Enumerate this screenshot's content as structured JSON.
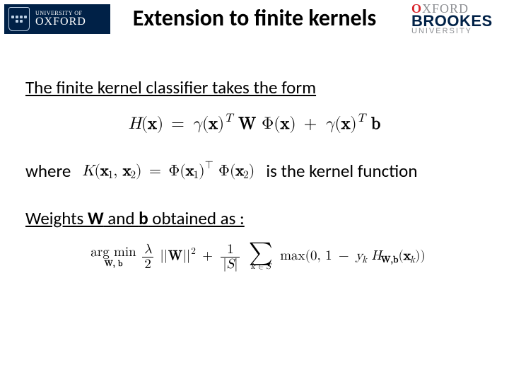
{
  "header": {
    "title": "Extension to finite kernels",
    "oxford": {
      "line1": "UNIVERSITY OF",
      "line2": "OXFORD"
    },
    "brookes": {
      "line1_o": "O",
      "line1_rest": "XFORD",
      "line2": "BROOKES",
      "line3": "UNIVERSITY"
    }
  },
  "body": {
    "intro": "The finite kernel classifier takes the form",
    "where": "where",
    "kernel_suffix": "is the kernel function",
    "weights_prefix": "Weights ",
    "weights_W": "W",
    "weights_and": " and ",
    "weights_b": "b",
    "weights_suffix": " obtained as :"
  },
  "math": {
    "H": "H",
    "x": "x",
    "gamma": "γ",
    "T": "T",
    "W": "W",
    "Phi": "Φ",
    "b": "b",
    "K": "K",
    "x1": "1",
    "x2": "2",
    "top_dot": "⊤",
    "argmin": "arg min",
    "argmin_sub": "W, b",
    "lambda": "λ",
    "two": "2",
    "plus": "+",
    "one": "1",
    "S": "S",
    "sum": "∑",
    "sum_sub": "k ∈ S",
    "max": "max",
    "zero": "0",
    "minus": "−",
    "yk_y": "y",
    "yk_k": "k",
    "HWb": "W,b",
    "xk_k": "k"
  }
}
